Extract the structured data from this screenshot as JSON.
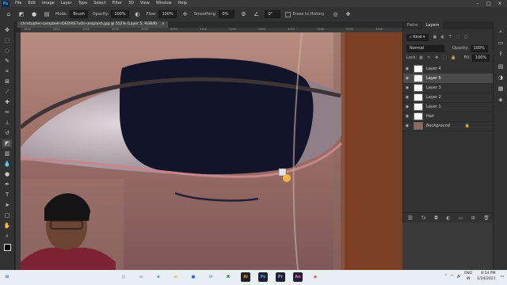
{
  "app": {
    "name": "Ps"
  },
  "menu": [
    "File",
    "Edit",
    "Image",
    "Layer",
    "Type",
    "Select",
    "Filter",
    "3D",
    "View",
    "Window",
    "Help"
  ],
  "options": {
    "mode_label": "Mode:",
    "mode_value": "Brush",
    "opacity_label": "Opacity:",
    "opacity_value": "100%",
    "flow_label": "Flow:",
    "flow_value": "100%",
    "smoothing_label": "Smoothing:",
    "smoothing_value": "0%",
    "angle_value": "0°",
    "erase_history_label": "Erase to History"
  },
  "document": {
    "tab_title": "christopher-campbell-rDEOVtE7vOs-unsplash.jpg @ 552% (Layer 5, RGB/8)",
    "ruler_ticks": [
      "2800",
      "2850",
      "2900",
      "2950",
      "3000",
      "3050",
      "3100",
      "3150",
      "3200",
      "3250",
      "3300",
      "3350",
      "3400"
    ]
  },
  "panel": {
    "tabs": [
      "Paths",
      "Layers"
    ],
    "active_tab": "Layers",
    "kind_label": "Kind",
    "blend_mode": "Normal",
    "opacity_label": "Opacity:",
    "opacity_value": "100%",
    "lock_label": "Lock:",
    "fill_label": "Fill:",
    "fill_value": "100%",
    "layers": [
      {
        "name": "Layer 4",
        "selected": false
      },
      {
        "name": "Layer 5",
        "selected": true
      },
      {
        "name": "Layer 3",
        "selected": false
      },
      {
        "name": "Layer 2",
        "selected": false
      },
      {
        "name": "Layer 1",
        "selected": false
      },
      {
        "name": "Hair",
        "selected": false
      },
      {
        "name": "Background",
        "selected": false,
        "locked": true
      }
    ]
  },
  "taskbar": {
    "apps": [
      {
        "icon": "windows-icon",
        "label": "⊞",
        "color": "#2b6bd6"
      },
      {
        "icon": "search-icon",
        "label": "○",
        "color": "#333333"
      },
      {
        "icon": "task-view-icon",
        "label": "▭",
        "color": "#333333"
      },
      {
        "icon": "edge-icon",
        "label": "e",
        "color": "#1f8fd6"
      },
      {
        "icon": "file-explorer-icon",
        "label": "▬",
        "color": "#f0b43a"
      },
      {
        "icon": "store-icon",
        "label": "■",
        "color": "#2b6bd6"
      },
      {
        "icon": "mail-icon",
        "label": "✉",
        "color": "#2b6bd6"
      },
      {
        "icon": "xbox-icon",
        "label": "X",
        "color": "#107c10"
      },
      {
        "icon": "illustrator-icon",
        "label": "Ai",
        "color": "#ff9a00"
      },
      {
        "icon": "photoshop-icon",
        "label": "Ps",
        "color": "#31a8ff"
      },
      {
        "icon": "premiere-icon",
        "label": "Pr",
        "color": "#9999ff"
      },
      {
        "icon": "animate-icon",
        "label": "An",
        "color": "#ff61f6"
      },
      {
        "icon": "chrome-icon",
        "label": "◉",
        "color": "#db4437"
      }
    ],
    "language": "ENG",
    "region": "IN",
    "time": "8:54 PM",
    "date": "1/24/2021"
  }
}
